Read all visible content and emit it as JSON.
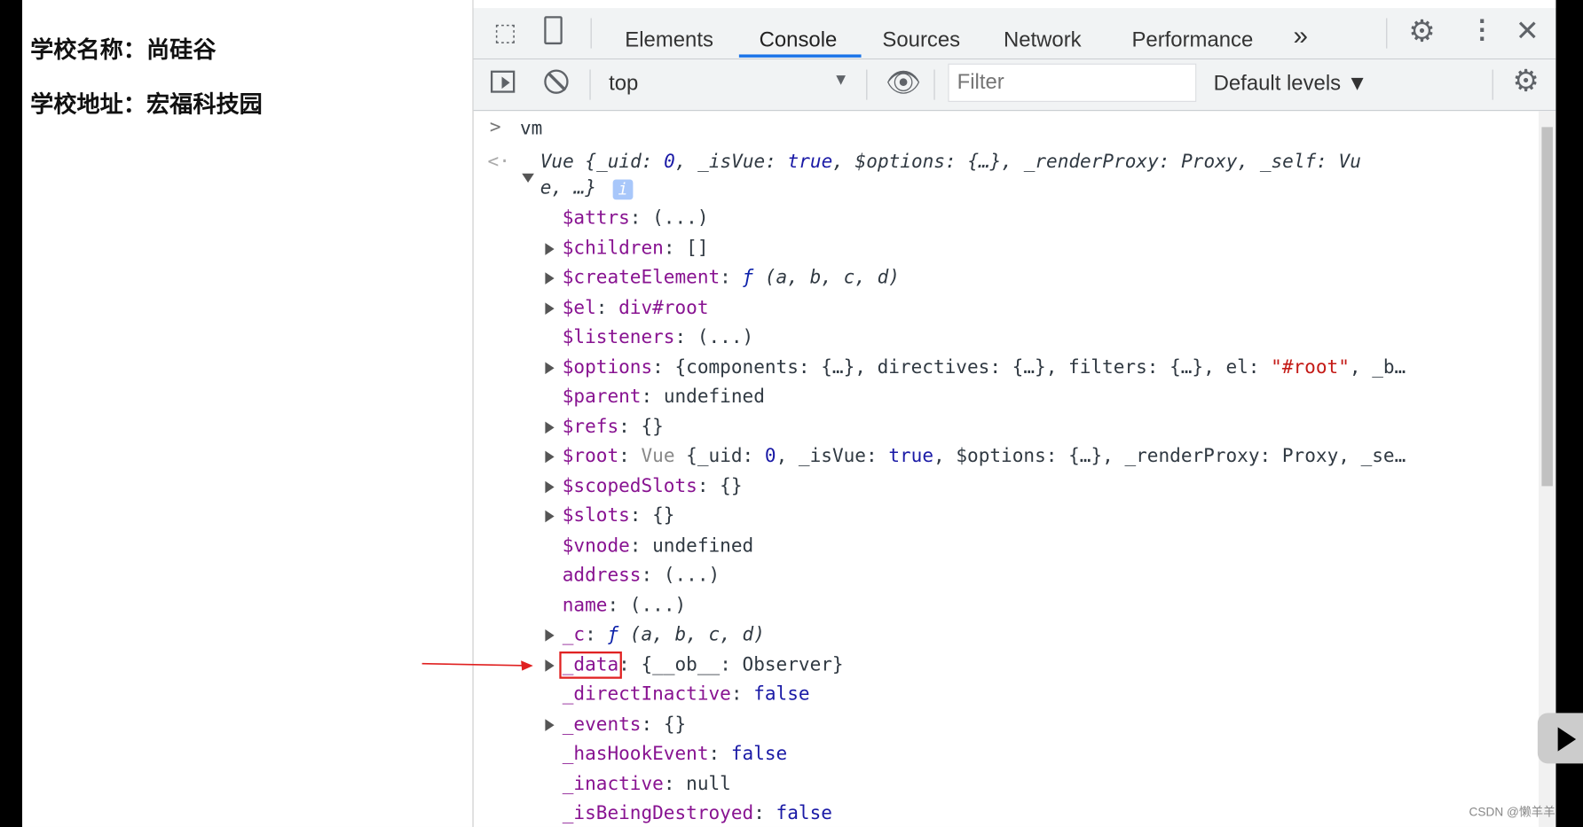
{
  "page": {
    "school_name": "学校名称：尚硅谷",
    "school_address": "学校地址：宏福科技园"
  },
  "devtools": {
    "tabs": [
      "Elements",
      "Console",
      "Sources",
      "Network",
      "Performance"
    ],
    "more_tabs": "»",
    "context": "top",
    "filter_placeholder": "Filter",
    "levels": "Default levels ▼"
  },
  "console": {
    "input": "vm",
    "summary_line1": [
      {
        "t": "Vue {_uid: ",
        "c": "it"
      },
      {
        "t": "0",
        "c": "b it"
      },
      {
        "t": ", _isVue: ",
        "c": "it"
      },
      {
        "t": "true",
        "c": "b it"
      },
      {
        "t": ", $options: {…}, _renderProxy: Proxy, _self: Vu",
        "c": "it"
      }
    ],
    "summary_line2": "e, …}",
    "info_badge": "i",
    "props": [
      {
        "expand": false,
        "seg": [
          {
            "t": "$attrs",
            "c": "k"
          },
          {
            "t": ": (...)",
            "c": ""
          }
        ]
      },
      {
        "expand": true,
        "seg": [
          {
            "t": "$children",
            "c": "k"
          },
          {
            "t": ": []",
            "c": ""
          }
        ]
      },
      {
        "expand": true,
        "seg": [
          {
            "t": "$createElement",
            "c": "k"
          },
          {
            "t": ": ",
            "c": ""
          },
          {
            "t": "ƒ",
            "c": "f"
          },
          {
            "t": " (a, b, c, d)",
            "c": "it"
          }
        ]
      },
      {
        "expand": true,
        "seg": [
          {
            "t": "$el",
            "c": "k"
          },
          {
            "t": ": ",
            "c": ""
          },
          {
            "t": "div#root",
            "c": "k"
          }
        ]
      },
      {
        "expand": false,
        "seg": [
          {
            "t": "$listeners",
            "c": "k"
          },
          {
            "t": ": (...)",
            "c": ""
          }
        ]
      },
      {
        "expand": true,
        "seg": [
          {
            "t": "$options",
            "c": "k"
          },
          {
            "t": ": {components: {…}, directives: {…}, filters: {…}, el: ",
            "c": ""
          },
          {
            "t": "\"#root\"",
            "c": "s"
          },
          {
            "t": ", _b…",
            "c": ""
          }
        ]
      },
      {
        "expand": false,
        "seg": [
          {
            "t": "$parent",
            "c": "k"
          },
          {
            "t": ": undefined",
            "c": ""
          }
        ]
      },
      {
        "expand": true,
        "seg": [
          {
            "t": "$refs",
            "c": "k"
          },
          {
            "t": ": {}",
            "c": ""
          }
        ]
      },
      {
        "expand": true,
        "seg": [
          {
            "t": "$root",
            "c": "k"
          },
          {
            "t": ": ",
            "c": ""
          },
          {
            "t": "Vue",
            "c": "d"
          },
          {
            "t": " {_uid: ",
            "c": ""
          },
          {
            "t": "0",
            "c": "b"
          },
          {
            "t": ", _isVue: ",
            "c": ""
          },
          {
            "t": "true",
            "c": "b"
          },
          {
            "t": ", $options: {…}, _renderProxy: Proxy, _se…",
            "c": ""
          }
        ]
      },
      {
        "expand": true,
        "seg": [
          {
            "t": "$scopedSlots",
            "c": "k"
          },
          {
            "t": ": {}",
            "c": ""
          }
        ]
      },
      {
        "expand": true,
        "seg": [
          {
            "t": "$slots",
            "c": "k"
          },
          {
            "t": ": {}",
            "c": ""
          }
        ]
      },
      {
        "expand": false,
        "seg": [
          {
            "t": "$vnode",
            "c": "k"
          },
          {
            "t": ": undefined",
            "c": ""
          }
        ]
      },
      {
        "expand": false,
        "seg": [
          {
            "t": "address",
            "c": "k"
          },
          {
            "t": ": (...)",
            "c": ""
          }
        ]
      },
      {
        "expand": false,
        "seg": [
          {
            "t": "name",
            "c": "k"
          },
          {
            "t": ": (...)",
            "c": ""
          }
        ]
      },
      {
        "expand": true,
        "seg": [
          {
            "t": "_c",
            "c": "k"
          },
          {
            "t": ": ",
            "c": ""
          },
          {
            "t": "ƒ",
            "c": "f"
          },
          {
            "t": " (a, b, c, d)",
            "c": "it"
          }
        ]
      },
      {
        "expand": true,
        "highlight": true,
        "seg": [
          {
            "t": "_data",
            "c": "k"
          },
          {
            "t": ": {__ob__: Observer}",
            "c": ""
          }
        ]
      },
      {
        "expand": false,
        "seg": [
          {
            "t": "_directInactive",
            "c": "k"
          },
          {
            "t": ": ",
            "c": ""
          },
          {
            "t": "false",
            "c": "b"
          }
        ]
      },
      {
        "expand": true,
        "seg": [
          {
            "t": "_events",
            "c": "k"
          },
          {
            "t": ": {}",
            "c": ""
          }
        ]
      },
      {
        "expand": false,
        "seg": [
          {
            "t": "_hasHookEvent",
            "c": "k"
          },
          {
            "t": ": ",
            "c": ""
          },
          {
            "t": "false",
            "c": "b"
          }
        ]
      },
      {
        "expand": false,
        "seg": [
          {
            "t": "_inactive",
            "c": "k"
          },
          {
            "t": ": null",
            "c": ""
          }
        ]
      },
      {
        "expand": false,
        "seg": [
          {
            "t": "_isBeingDestroyed",
            "c": "k"
          },
          {
            "t": ": ",
            "c": ""
          },
          {
            "t": "false",
            "c": "b"
          }
        ]
      }
    ]
  },
  "watermark": "CSDN @懒羊羊",
  "colors": {
    "annotation": "#e02020",
    "accent": "#1a73e8"
  }
}
